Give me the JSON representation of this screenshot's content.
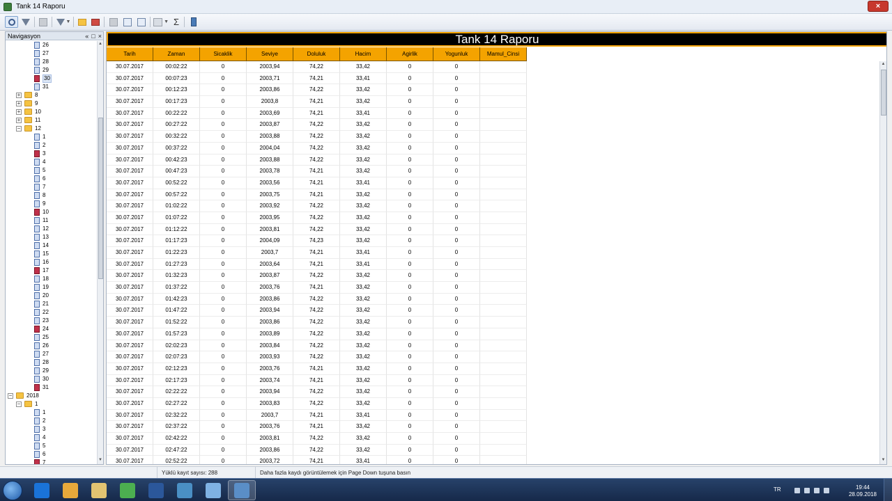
{
  "window": {
    "title": "Tank 14 Raporu",
    "close_glyph": "×"
  },
  "toolbar": {
    "icons": [
      "search-icon",
      "filter-icon",
      "nav-pane-icon",
      "funnel-icon",
      "open-icon",
      "export-icon",
      "first-page-icon",
      "book-icon",
      "zoom-page-icon",
      "grid-layout-icon",
      "sigma-icon",
      "tank-icon"
    ],
    "sigma_glyph": "Σ"
  },
  "navigation": {
    "title": "Navigasyon",
    "header_buttons": [
      "«",
      "□",
      "×"
    ],
    "tree": [
      {
        "label": "26",
        "type": "doc",
        "level": 3,
        "red": false
      },
      {
        "label": "27",
        "type": "doc",
        "level": 3,
        "red": false
      },
      {
        "label": "28",
        "type": "doc",
        "level": 3,
        "red": false
      },
      {
        "label": "29",
        "type": "doc",
        "level": 3,
        "red": false
      },
      {
        "label": "30",
        "type": "doc",
        "level": 3,
        "red": true,
        "selected": true
      },
      {
        "label": "31",
        "type": "doc",
        "level": 3,
        "red": false
      },
      {
        "label": "8",
        "type": "folder",
        "level": 2,
        "expanded": false
      },
      {
        "label": "9",
        "type": "folder",
        "level": 2,
        "expanded": false
      },
      {
        "label": "10",
        "type": "folder",
        "level": 2,
        "expanded": false
      },
      {
        "label": "11",
        "type": "folder",
        "level": 2,
        "expanded": false
      },
      {
        "label": "12",
        "type": "folder",
        "level": 2,
        "expanded": true
      },
      {
        "label": "1",
        "type": "doc",
        "level": 3,
        "red": false
      },
      {
        "label": "2",
        "type": "doc",
        "level": 3,
        "red": false
      },
      {
        "label": "3",
        "type": "doc",
        "level": 3,
        "red": true
      },
      {
        "label": "4",
        "type": "doc",
        "level": 3,
        "red": false
      },
      {
        "label": "5",
        "type": "doc",
        "level": 3,
        "red": false
      },
      {
        "label": "6",
        "type": "doc",
        "level": 3,
        "red": false
      },
      {
        "label": "7",
        "type": "doc",
        "level": 3,
        "red": false
      },
      {
        "label": "8",
        "type": "doc",
        "level": 3,
        "red": false
      },
      {
        "label": "9",
        "type": "doc",
        "level": 3,
        "red": false
      },
      {
        "label": "10",
        "type": "doc",
        "level": 3,
        "red": true
      },
      {
        "label": "11",
        "type": "doc",
        "level": 3,
        "red": false
      },
      {
        "label": "12",
        "type": "doc",
        "level": 3,
        "red": false
      },
      {
        "label": "13",
        "type": "doc",
        "level": 3,
        "red": false
      },
      {
        "label": "14",
        "type": "doc",
        "level": 3,
        "red": false
      },
      {
        "label": "15",
        "type": "doc",
        "level": 3,
        "red": false
      },
      {
        "label": "16",
        "type": "doc",
        "level": 3,
        "red": false
      },
      {
        "label": "17",
        "type": "doc",
        "level": 3,
        "red": true
      },
      {
        "label": "18",
        "type": "doc",
        "level": 3,
        "red": false
      },
      {
        "label": "19",
        "type": "doc",
        "level": 3,
        "red": false
      },
      {
        "label": "20",
        "type": "doc",
        "level": 3,
        "red": false
      },
      {
        "label": "21",
        "type": "doc",
        "level": 3,
        "red": false
      },
      {
        "label": "22",
        "type": "doc",
        "level": 3,
        "red": false
      },
      {
        "label": "23",
        "type": "doc",
        "level": 3,
        "red": false
      },
      {
        "label": "24",
        "type": "doc",
        "level": 3,
        "red": true
      },
      {
        "label": "25",
        "type": "doc",
        "level": 3,
        "red": false
      },
      {
        "label": "26",
        "type": "doc",
        "level": 3,
        "red": false
      },
      {
        "label": "27",
        "type": "doc",
        "level": 3,
        "red": false
      },
      {
        "label": "28",
        "type": "doc",
        "level": 3,
        "red": false
      },
      {
        "label": "29",
        "type": "doc",
        "level": 3,
        "red": false
      },
      {
        "label": "30",
        "type": "doc",
        "level": 3,
        "red": false
      },
      {
        "label": "31",
        "type": "doc",
        "level": 3,
        "red": true
      },
      {
        "label": "2018",
        "type": "folder",
        "level": 1,
        "expanded": true
      },
      {
        "label": "1",
        "type": "folder",
        "level": 2,
        "expanded": true
      },
      {
        "label": "1",
        "type": "doc",
        "level": 3,
        "red": false
      },
      {
        "label": "2",
        "type": "doc",
        "level": 3,
        "red": false
      },
      {
        "label": "3",
        "type": "doc",
        "level": 3,
        "red": false
      },
      {
        "label": "4",
        "type": "doc",
        "level": 3,
        "red": false
      },
      {
        "label": "5",
        "type": "doc",
        "level": 3,
        "red": false
      },
      {
        "label": "6",
        "type": "doc",
        "level": 3,
        "red": false
      },
      {
        "label": "7",
        "type": "doc",
        "level": 3,
        "red": true
      }
    ]
  },
  "report": {
    "title": "Tank 14 Raporu",
    "columns": [
      "Tarih",
      "Zaman",
      "Sicaklik",
      "Seviye",
      "Doluluk",
      "Hacim",
      "Agirlik",
      "Yogunluk",
      "Mamul_Cinsi"
    ],
    "rows": [
      [
        "30.07.2017",
        "00:02:22",
        "0",
        "2003,94",
        "74,22",
        "33,42",
        "0",
        "0",
        ""
      ],
      [
        "30.07.2017",
        "00:07:23",
        "0",
        "2003,71",
        "74,21",
        "33,41",
        "0",
        "0",
        ""
      ],
      [
        "30.07.2017",
        "00:12:23",
        "0",
        "2003,86",
        "74,22",
        "33,42",
        "0",
        "0",
        ""
      ],
      [
        "30.07.2017",
        "00:17:23",
        "0",
        "2003,8",
        "74,21",
        "33,42",
        "0",
        "0",
        ""
      ],
      [
        "30.07.2017",
        "00:22:22",
        "0",
        "2003,69",
        "74,21",
        "33,41",
        "0",
        "0",
        ""
      ],
      [
        "30.07.2017",
        "00:27:22",
        "0",
        "2003,87",
        "74,22",
        "33,42",
        "0",
        "0",
        ""
      ],
      [
        "30.07.2017",
        "00:32:22",
        "0",
        "2003,88",
        "74,22",
        "33,42",
        "0",
        "0",
        ""
      ],
      [
        "30.07.2017",
        "00:37:22",
        "0",
        "2004,04",
        "74,22",
        "33,42",
        "0",
        "0",
        ""
      ],
      [
        "30.07.2017",
        "00:42:23",
        "0",
        "2003,88",
        "74,22",
        "33,42",
        "0",
        "0",
        ""
      ],
      [
        "30.07.2017",
        "00:47:23",
        "0",
        "2003,78",
        "74,21",
        "33,42",
        "0",
        "0",
        ""
      ],
      [
        "30.07.2017",
        "00:52:22",
        "0",
        "2003,56",
        "74,21",
        "33,41",
        "0",
        "0",
        ""
      ],
      [
        "30.07.2017",
        "00:57:22",
        "0",
        "2003,75",
        "74,21",
        "33,42",
        "0",
        "0",
        ""
      ],
      [
        "30.07.2017",
        "01:02:22",
        "0",
        "2003,92",
        "74,22",
        "33,42",
        "0",
        "0",
        ""
      ],
      [
        "30.07.2017",
        "01:07:22",
        "0",
        "2003,95",
        "74,22",
        "33,42",
        "0",
        "0",
        ""
      ],
      [
        "30.07.2017",
        "01:12:22",
        "0",
        "2003,81",
        "74,22",
        "33,42",
        "0",
        "0",
        ""
      ],
      [
        "30.07.2017",
        "01:17:23",
        "0",
        "2004,09",
        "74,23",
        "33,42",
        "0",
        "0",
        ""
      ],
      [
        "30.07.2017",
        "01:22:23",
        "0",
        "2003,7",
        "74,21",
        "33,41",
        "0",
        "0",
        ""
      ],
      [
        "30.07.2017",
        "01:27:23",
        "0",
        "2003,64",
        "74,21",
        "33,41",
        "0",
        "0",
        ""
      ],
      [
        "30.07.2017",
        "01:32:23",
        "0",
        "2003,87",
        "74,22",
        "33,42",
        "0",
        "0",
        ""
      ],
      [
        "30.07.2017",
        "01:37:22",
        "0",
        "2003,76",
        "74,21",
        "33,42",
        "0",
        "0",
        ""
      ],
      [
        "30.07.2017",
        "01:42:23",
        "0",
        "2003,86",
        "74,22",
        "33,42",
        "0",
        "0",
        ""
      ],
      [
        "30.07.2017",
        "01:47:22",
        "0",
        "2003,94",
        "74,22",
        "33,42",
        "0",
        "0",
        ""
      ],
      [
        "30.07.2017",
        "01:52:22",
        "0",
        "2003,86",
        "74,22",
        "33,42",
        "0",
        "0",
        ""
      ],
      [
        "30.07.2017",
        "01:57:23",
        "0",
        "2003,89",
        "74,22",
        "33,42",
        "0",
        "0",
        ""
      ],
      [
        "30.07.2017",
        "02:02:23",
        "0",
        "2003,84",
        "74,22",
        "33,42",
        "0",
        "0",
        ""
      ],
      [
        "30.07.2017",
        "02:07:23",
        "0",
        "2003,93",
        "74,22",
        "33,42",
        "0",
        "0",
        ""
      ],
      [
        "30.07.2017",
        "02:12:23",
        "0",
        "2003,76",
        "74,21",
        "33,42",
        "0",
        "0",
        ""
      ],
      [
        "30.07.2017",
        "02:17:23",
        "0",
        "2003,74",
        "74,21",
        "33,42",
        "0",
        "0",
        ""
      ],
      [
        "30.07.2017",
        "02:22:22",
        "0",
        "2003,94",
        "74,22",
        "33,42",
        "0",
        "0",
        ""
      ],
      [
        "30.07.2017",
        "02:27:22",
        "0",
        "2003,83",
        "74,22",
        "33,42",
        "0",
        "0",
        ""
      ],
      [
        "30.07.2017",
        "02:32:22",
        "0",
        "2003,7",
        "74,21",
        "33,41",
        "0",
        "0",
        ""
      ],
      [
        "30.07.2017",
        "02:37:22",
        "0",
        "2003,76",
        "74,21",
        "33,42",
        "0",
        "0",
        ""
      ],
      [
        "30.07.2017",
        "02:42:22",
        "0",
        "2003,81",
        "74,22",
        "33,42",
        "0",
        "0",
        ""
      ],
      [
        "30.07.2017",
        "02:47:22",
        "0",
        "2003,86",
        "74,22",
        "33,42",
        "0",
        "0",
        ""
      ],
      [
        "30.07.2017",
        "02:52:22",
        "0",
        "2003,72",
        "74,21",
        "33,41",
        "0",
        "0",
        ""
      ]
    ]
  },
  "status": {
    "record_count": "Yüklü kayıt sayısı: 288",
    "hint": "Daha fazla kaydı görüntülemek için Page Down tuşuna basın"
  },
  "taskbar": {
    "apps": [
      "internet-explorer-icon",
      "outlook-icon",
      "file-explorer-icon",
      "chrome-icon",
      "word-icon",
      "scada-icon",
      "paint-icon",
      "tank-app-icon"
    ],
    "app_colors": [
      "#1a73d8",
      "#e8a93b",
      "#e2c371",
      "#4caf50",
      "#2b579a",
      "#4a8fc4",
      "#7fb2e3",
      "#5a8ec7"
    ],
    "language": "TR",
    "time": "19:44",
    "date": "28.09.2018"
  },
  "colors": {
    "header_orange": "#f4a300",
    "title_black": "#000000",
    "red_doc": "#c0314a"
  }
}
